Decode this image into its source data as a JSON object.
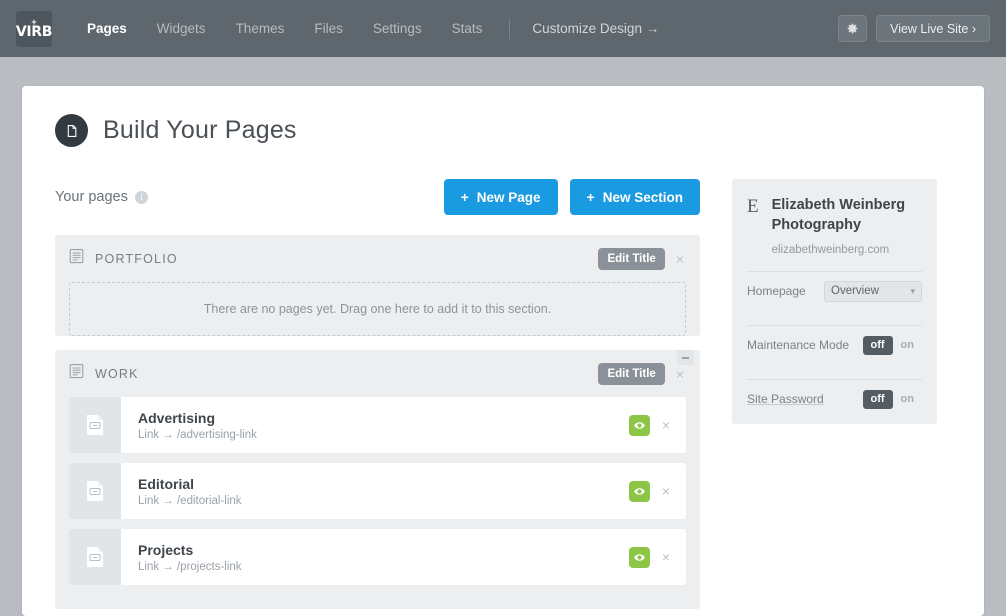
{
  "topbar": {
    "logo": {
      "plus": "+",
      "text": "VIRB",
      "icon": "virb-logo-icon"
    },
    "nav": [
      {
        "label": "Pages",
        "active": true
      },
      {
        "label": "Widgets",
        "active": false
      },
      {
        "label": "Themes",
        "active": false
      },
      {
        "label": "Files",
        "active": false
      },
      {
        "label": "Settings",
        "active": false
      },
      {
        "label": "Stats",
        "active": false
      }
    ],
    "customize_label": "Customize Design →",
    "gear_icon": "gear-icon",
    "view_live_label": "View Live Site ›"
  },
  "page": {
    "title": "Build Your Pages",
    "badge_icon": "document-icon"
  },
  "subhead": {
    "label": "Your pages",
    "info_icon": "info-icon",
    "info_glyph": "i",
    "new_page_label": "New Page",
    "new_section_label": "New Section",
    "plus_glyph": "+"
  },
  "sections": [
    {
      "name": "PORTFOLIO",
      "icon": "section-list-icon",
      "edit_label": "Edit Title",
      "close_glyph": "×",
      "empty_message": "There are no pages yet. Drag one here to add it to this section.",
      "collapsible": false,
      "pages": []
    },
    {
      "name": "WORK",
      "icon": "section-list-icon",
      "edit_label": "Edit Title",
      "close_glyph": "×",
      "empty_message": "",
      "collapsible": true,
      "pages": [
        {
          "title": "Advertising",
          "subtitle": "Link → /advertising-link",
          "icon": "link-page-icon",
          "visibility_icon": "eye-icon",
          "close_glyph": "×"
        },
        {
          "title": "Editorial",
          "subtitle": "Link → /editorial-link",
          "icon": "link-page-icon",
          "visibility_icon": "eye-icon",
          "close_glyph": "×"
        },
        {
          "title": "Projects",
          "subtitle": "Link → /projects-link",
          "icon": "link-page-icon",
          "visibility_icon": "eye-icon",
          "close_glyph": "×"
        }
      ]
    }
  ],
  "sidebar": {
    "avatar_letter": "E",
    "site_name": "Elizabeth Weinberg Photography",
    "domain": "elizabethweinberg.com",
    "settings": [
      {
        "label": "Homepage",
        "type": "select",
        "value": "Overview",
        "chevron": "⌄"
      },
      {
        "label": "Maintenance Mode",
        "type": "toggle",
        "off_label": "off",
        "on_label": "on",
        "value": "off"
      },
      {
        "label": "Site Password",
        "type": "toggle",
        "off_label": "off",
        "on_label": "on",
        "value": "off"
      }
    ]
  },
  "colors": {
    "topbar": "#5e676e",
    "page_background": "#b9bdc1",
    "accent_blue": "#1a9ae0",
    "accent_green": "#8dc646",
    "section_gray": "#eceef0"
  }
}
